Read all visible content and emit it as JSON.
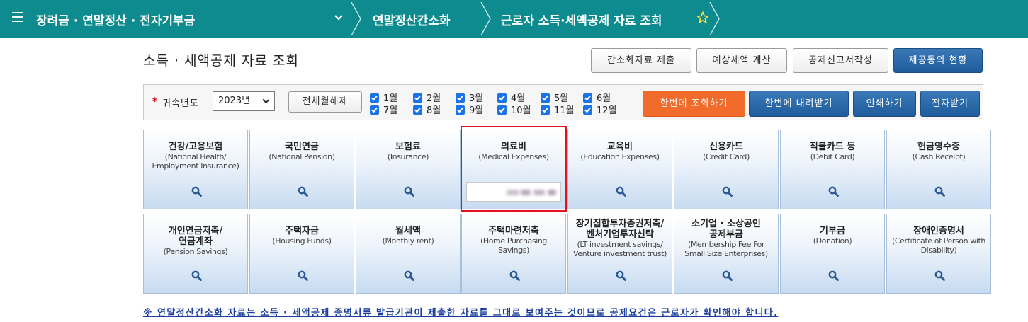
{
  "topbar": {
    "crumb1": "장려금 · 연말정산 · 전자기부금",
    "crumb2": "연말정산간소화",
    "crumb3": "근로자 소득·세액공제 자료 조회"
  },
  "page": {
    "title": "소득 · 세액공제 자료 조회"
  },
  "actions": {
    "submit": "간소화자료 제출",
    "estimate": "예상세액 계산",
    "deduction_form": "공제신고서작성",
    "provision_status": "제공동의 현황"
  },
  "filter": {
    "required_mark": "*",
    "year_label": "귀속년도",
    "year_value": "2023년",
    "toggle_all": "전체월해제",
    "months": [
      {
        "label": "1월",
        "checked": true
      },
      {
        "label": "2월",
        "checked": true
      },
      {
        "label": "3월",
        "checked": true
      },
      {
        "label": "4월",
        "checked": true
      },
      {
        "label": "5월",
        "checked": true
      },
      {
        "label": "6월",
        "checked": true
      },
      {
        "label": "7월",
        "checked": true
      },
      {
        "label": "8월",
        "checked": true
      },
      {
        "label": "9월",
        "checked": true
      },
      {
        "label": "10월",
        "checked": true
      },
      {
        "label": "11월",
        "checked": true
      },
      {
        "label": "12월",
        "checked": true
      }
    ],
    "query_all": "한번에 조회하기",
    "download_all": "한번에 내려받기",
    "print": "인쇄하기",
    "digital_sign": "전자받기"
  },
  "categories": [
    {
      "ko": [
        "건강/고용보험"
      ],
      "en": [
        "(National Health/",
        "Employment Insurance)"
      ]
    },
    {
      "ko": [
        "국민연금"
      ],
      "en": [
        "(National Pension)"
      ]
    },
    {
      "ko": [
        "보험료"
      ],
      "en": [
        "(Insurance)"
      ]
    },
    {
      "ko": [
        "의료비"
      ],
      "en": [
        "(Medical Expenses)"
      ]
    },
    {
      "ko": [
        "교육비"
      ],
      "en": [
        "(Education Expenses)"
      ]
    },
    {
      "ko": [
        "신용카드"
      ],
      "en": [
        "(Credit Card)"
      ]
    },
    {
      "ko": [
        "직불카드 등"
      ],
      "en": [
        "(Debit Card)"
      ]
    },
    {
      "ko": [
        "현금영수증"
      ],
      "en": [
        "(Cash Receipt)"
      ]
    },
    {
      "ko": [
        "개인연금저축/",
        "연금계좌"
      ],
      "en": [
        "(Pension Savings)"
      ]
    },
    {
      "ko": [
        "주택자금"
      ],
      "en": [
        "(Housing Funds)"
      ]
    },
    {
      "ko": [
        "월세액"
      ],
      "en": [
        "(Monthly rent)"
      ]
    },
    {
      "ko": [
        "주택마련저축"
      ],
      "en": [
        "(Home Purchasing",
        "Savings)"
      ]
    },
    {
      "ko": [
        "장기집합투자증권저축/",
        "벤처기업투자신탁"
      ],
      "en": [
        "(LT investment savings/",
        "Venture investment trust)"
      ]
    },
    {
      "ko": [
        "소기업 · 소상공인",
        "공제부금"
      ],
      "en": [
        "(Membership Fee For",
        "Small Size Enterprises)"
      ]
    },
    {
      "ko": [
        "기부금"
      ],
      "en": [
        "(Donation)"
      ]
    },
    {
      "ko": [
        "장애인증명서"
      ],
      "en": [
        "(Certificate of Person with",
        "Disability)"
      ]
    }
  ],
  "notice": "※ 연말정산간소화 자료는 소득 · 세액공제 증명서류 발급기관이 제출한 자료를 그대로 보여주는 것이므로 공제요건은 근로자가 확인해야 합니다.",
  "icons": {
    "menu": "menu-icon",
    "chevron": "chevron-down-icon",
    "favorite": "star-icon",
    "tile": "search-icon"
  },
  "colors": {
    "topbar": "#0e8b8f",
    "primary_button": "#1f5c9c",
    "accent_button": "#f16b2a",
    "highlight": "#e0141e",
    "notice": "#1c3f9e"
  }
}
